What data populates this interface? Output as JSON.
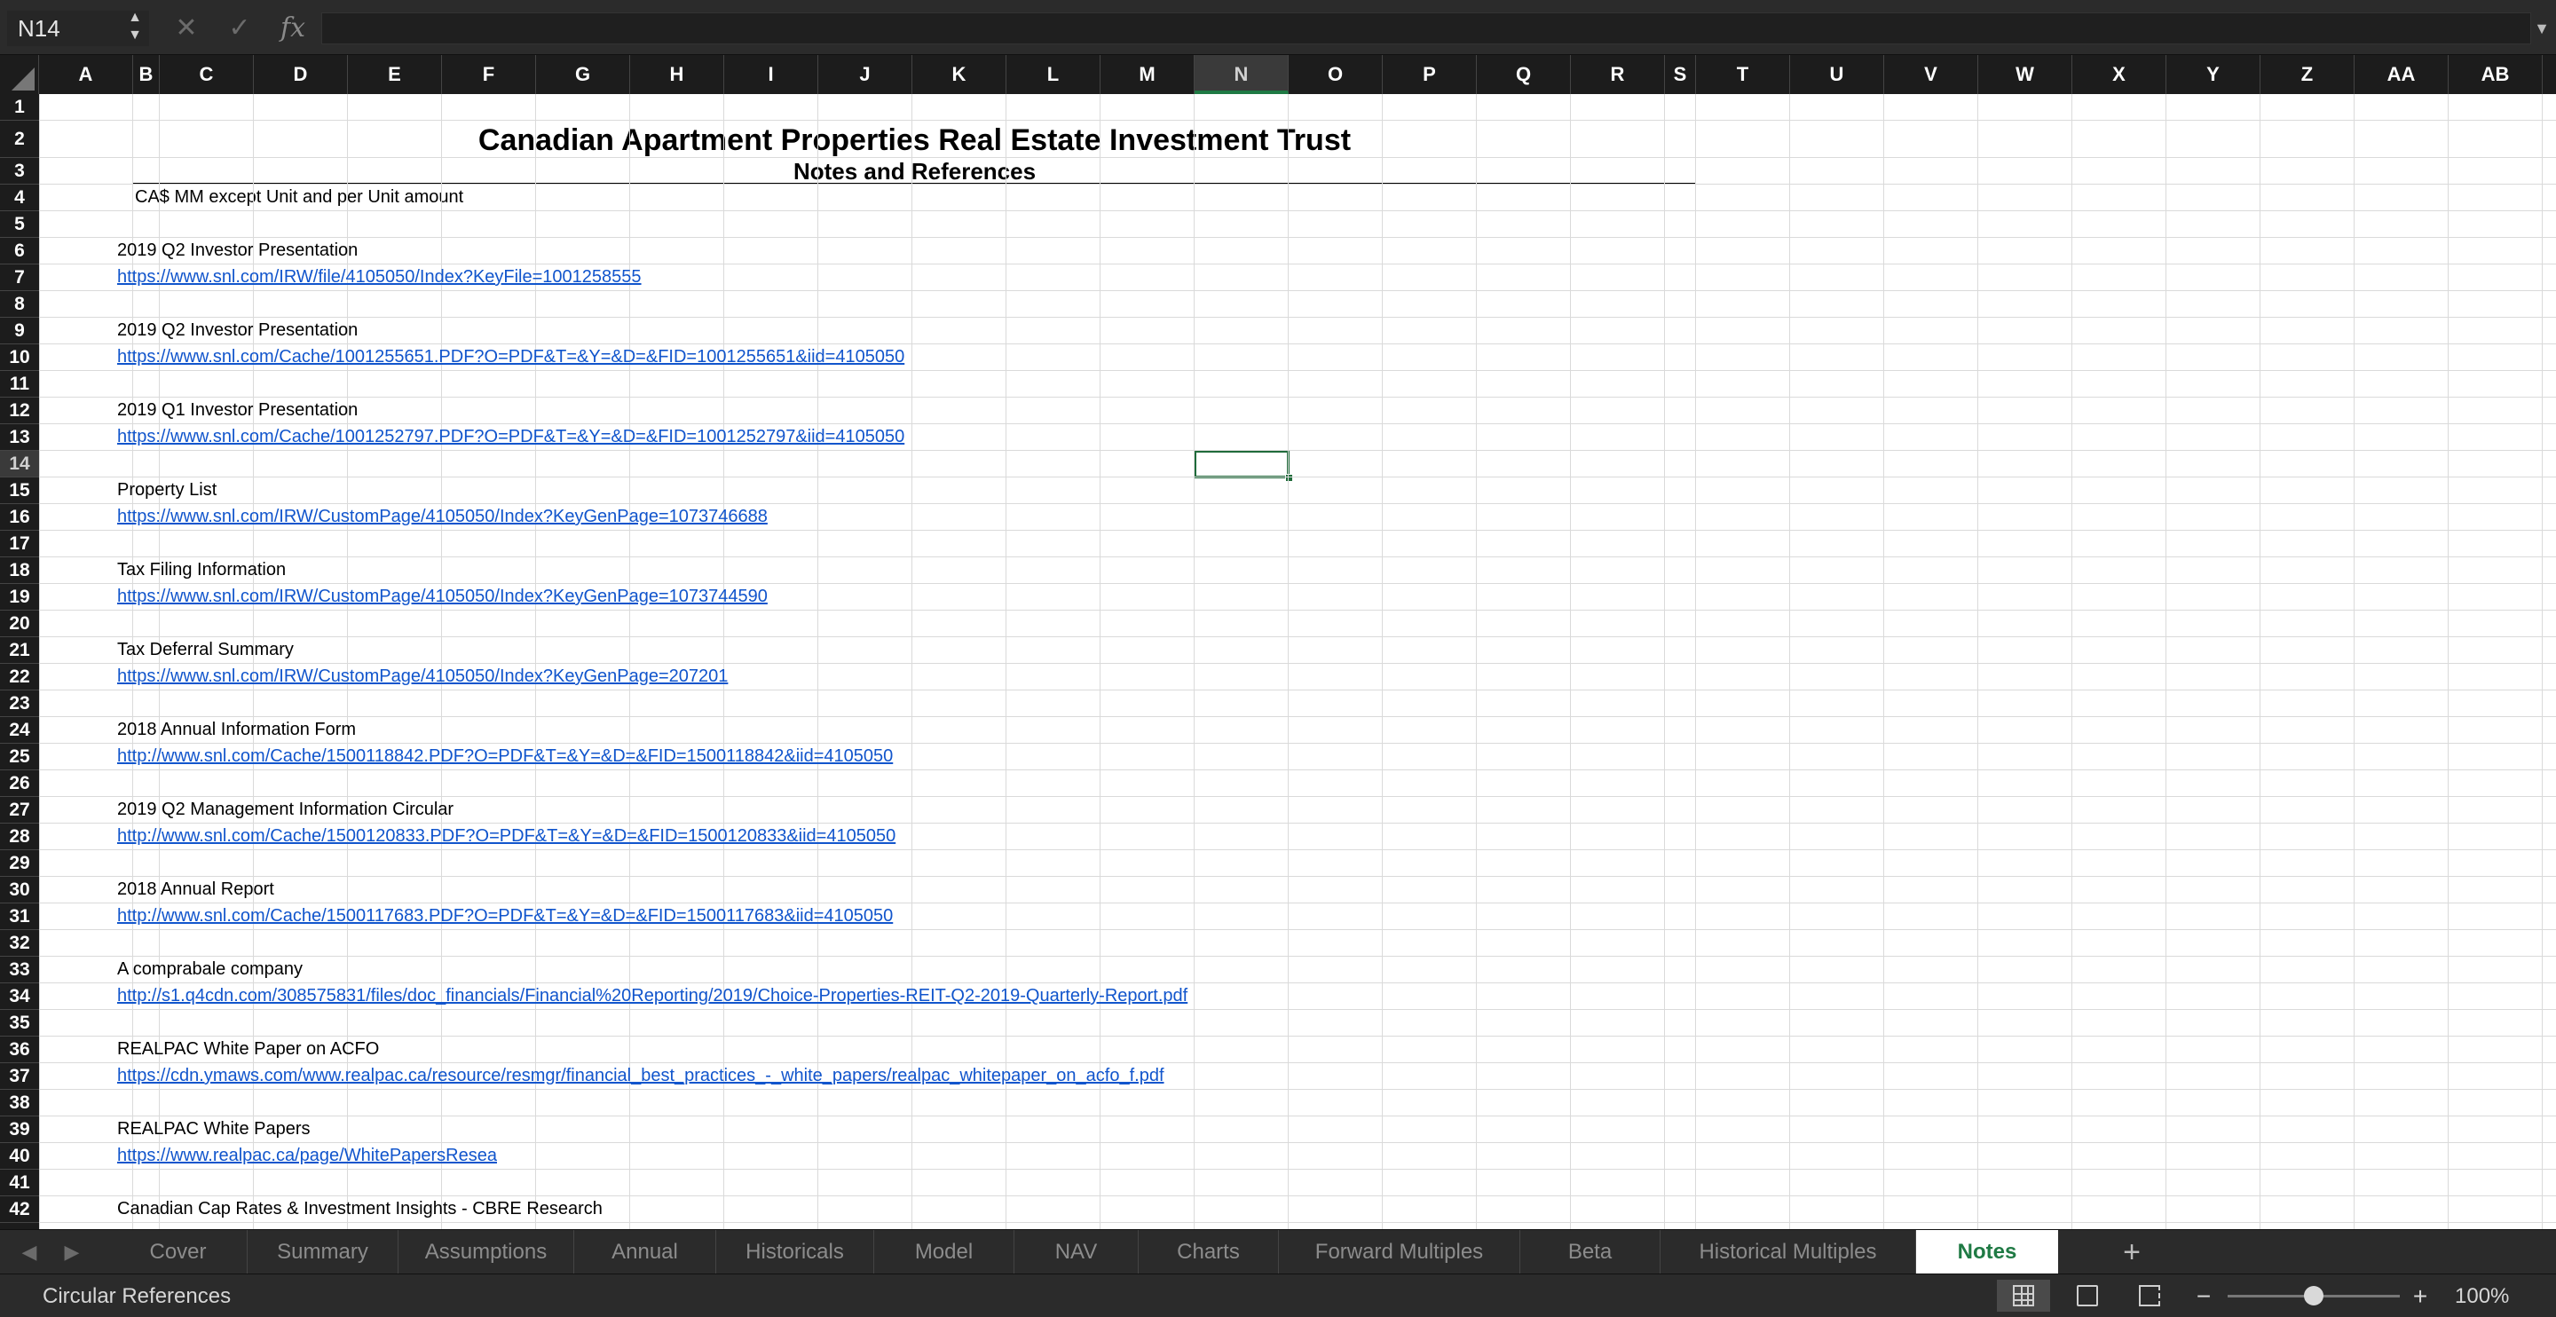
{
  "formula_bar": {
    "name_box": "N14",
    "cancel_icon": "x-icon",
    "confirm_icon": "check-icon",
    "fx_label": "fx",
    "formula": ""
  },
  "grid": {
    "columns": [
      "A",
      "B",
      "C",
      "D",
      "E",
      "F",
      "G",
      "H",
      "I",
      "J",
      "K",
      "L",
      "M",
      "N",
      "O",
      "P",
      "Q",
      "R",
      "S",
      "T",
      "U",
      "V",
      "W",
      "X",
      "Y",
      "Z",
      "AA",
      "AB"
    ],
    "selected_column": "N",
    "rows": [
      "1",
      "2",
      "3",
      "4",
      "5",
      "6",
      "7",
      "8",
      "9",
      "10",
      "11",
      "12",
      "13",
      "14",
      "15",
      "16",
      "17",
      "18",
      "19",
      "20",
      "21",
      "22",
      "23",
      "24",
      "25",
      "26",
      "27",
      "28",
      "29",
      "30",
      "31",
      "32",
      "33",
      "34",
      "35",
      "36",
      "37",
      "38",
      "39",
      "40",
      "41",
      "42"
    ],
    "selected_row": "14",
    "title": "Canadian Apartment Properties Real Estate Investment Trust",
    "subtitle": "Notes and References",
    "units_note": "CA$ MM except Unit and per Unit amount",
    "entries": [
      {
        "label": "2019 Q2 Investor Presentation",
        "link": "https://www.snl.com/IRW/file/4105050/Index?KeyFile=1001258555"
      },
      {
        "label": "2019 Q2 Investor Presentation",
        "link": "https://www.snl.com/Cache/1001255651.PDF?O=PDF&T=&Y=&D=&FID=1001255651&iid=4105050"
      },
      {
        "label": "2019 Q1 Investor Presentation",
        "link": "https://www.snl.com/Cache/1001252797.PDF?O=PDF&T=&Y=&D=&FID=1001252797&iid=4105050"
      },
      {
        "label": "Property List",
        "link": "https://www.snl.com/IRW/CustomPage/4105050/Index?KeyGenPage=1073746688"
      },
      {
        "label": "Tax Filing Information",
        "link": "https://www.snl.com/IRW/CustomPage/4105050/Index?KeyGenPage=1073744590"
      },
      {
        "label": "Tax Deferral Summary",
        "link": "https://www.snl.com/IRW/CustomPage/4105050/Index?KeyGenPage=207201"
      },
      {
        "label": "2018 Annual Information Form",
        "link": "http://www.snl.com/Cache/1500118842.PDF?O=PDF&T=&Y=&D=&FID=1500118842&iid=4105050"
      },
      {
        "label": "2019 Q2 Management Information Circular",
        "link": "http://www.snl.com/Cache/1500120833.PDF?O=PDF&T=&Y=&D=&FID=1500120833&iid=4105050"
      },
      {
        "label": "2018 Annual Report",
        "link": "http://www.snl.com/Cache/1500117683.PDF?O=PDF&T=&Y=&D=&FID=1500117683&iid=4105050"
      },
      {
        "label": "A comprabale company",
        "link": "http://s1.q4cdn.com/308575831/files/doc_financials/Financial%20Reporting/2019/Choice-Properties-REIT-Q2-2019-Quarterly-Report.pdf"
      },
      {
        "label": "REALPAC White Paper on ACFO",
        "link": "https://cdn.ymaws.com/www.realpac.ca/resource/resmgr/financial_best_practices_-_white_papers/realpac_whitepaper_on_acfo_f.pdf"
      },
      {
        "label": "REALPAC White Papers",
        "link": "https://www.realpac.ca/page/WhitePapersResea"
      },
      {
        "label": "Canadian Cap Rates & Investment Insights - CBRE Research",
        "link": ""
      }
    ]
  },
  "sheet_tabs": {
    "tabs": [
      "Cover",
      "Summary",
      "Assumptions",
      "Annual",
      "Historicals",
      "Model",
      "NAV",
      "Charts",
      "Forward Multiples",
      "Beta",
      "Historical Multiples",
      "Notes"
    ],
    "active": "Notes",
    "add_label": "+"
  },
  "status_bar": {
    "status": "Circular References",
    "zoom": "100%",
    "zoom_percent": 100,
    "views": [
      "normal-view-icon",
      "page-layout-view-icon",
      "page-break-view-icon"
    ]
  },
  "colors": {
    "accent": "#1f7a44",
    "link": "#1155cc",
    "chrome": "#2b2b2b",
    "header": "#1c1c1c"
  }
}
